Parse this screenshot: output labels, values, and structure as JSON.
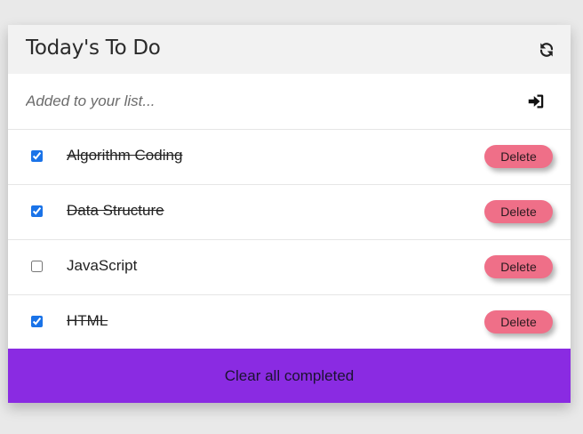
{
  "header": {
    "title": "Today's To Do",
    "refresh_icon": "refresh-icon"
  },
  "add": {
    "placeholder": "Added to your list...",
    "value": "",
    "submit_icon": "sign-in-icon"
  },
  "items": [
    {
      "label": "Algorithm Coding",
      "checked": true,
      "delete_label": "Delete"
    },
    {
      "label": "Data Structure",
      "checked": true,
      "delete_label": "Delete"
    },
    {
      "label": "JavaScript",
      "checked": false,
      "delete_label": "Delete"
    },
    {
      "label": "HTML",
      "checked": true,
      "delete_label": "Delete"
    }
  ],
  "footer": {
    "clear_label": "Clear all completed"
  },
  "colors": {
    "background": "#e9e9e9",
    "header_bg": "#f2f2f2",
    "delete_button": "#ef6f88",
    "footer_bg": "#8a2be2",
    "checkbox_accent": "#1a73e8"
  }
}
